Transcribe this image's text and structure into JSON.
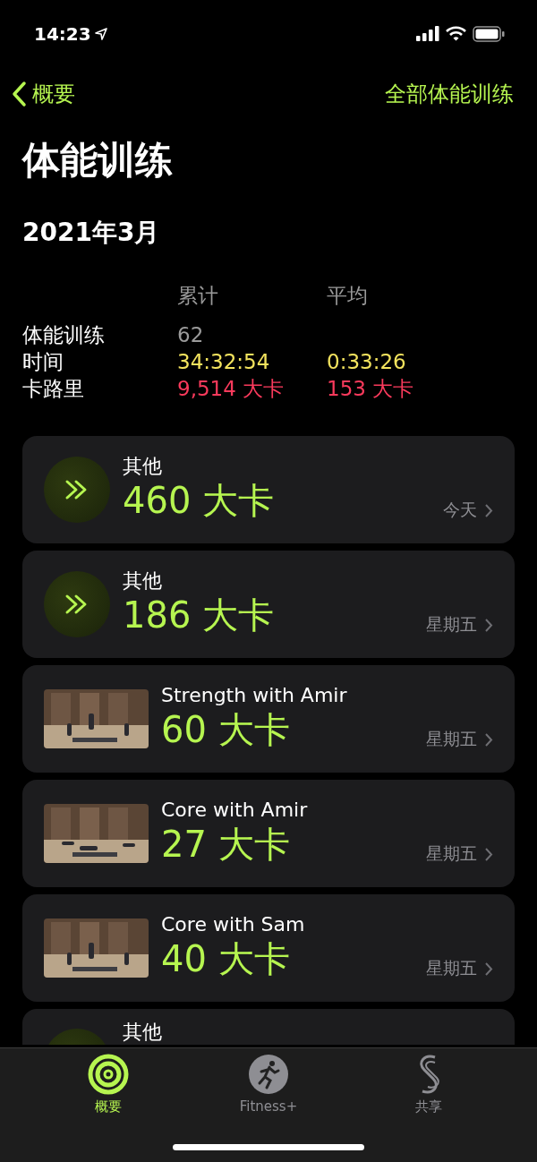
{
  "status_bar": {
    "time": "14:23"
  },
  "nav": {
    "back_label": "概要",
    "action_label": "全部体能训练"
  },
  "title": "体能训练",
  "month": "2021年3月",
  "summary": {
    "columns": [
      "累计",
      "平均"
    ],
    "rows": [
      {
        "kind": "count",
        "label": "体能训练",
        "values": [
          "62"
        ]
      },
      {
        "kind": "time",
        "label": "时间",
        "values": [
          "34:32:54",
          "0:33:26"
        ]
      },
      {
        "kind": "calories",
        "label": "卡路里",
        "values": [
          "9,514 大卡",
          "153 大卡"
        ]
      }
    ]
  },
  "workouts": [
    {
      "kind": "icon",
      "title": "其他",
      "calories": "460 大卡",
      "day": "今天"
    },
    {
      "kind": "icon",
      "title": "其他",
      "calories": "186 大卡",
      "day": "星期五"
    },
    {
      "kind": "picture",
      "title": "Strength with Amir",
      "calories": "60 大卡",
      "day": "星期五"
    },
    {
      "kind": "picture",
      "title": "Core with Amir",
      "calories": "27 大卡",
      "day": "星期五"
    },
    {
      "kind": "picture",
      "title": "Core with Sam",
      "calories": "40 大卡",
      "day": "星期五"
    },
    {
      "kind": "icon",
      "title": "其他"
    }
  ],
  "tab_bar": [
    {
      "kind": "summary",
      "label": "概要",
      "selected": true
    },
    {
      "kind": "fitness",
      "label": "Fitness+",
      "selected": false
    },
    {
      "kind": "sharing",
      "label": "共享",
      "selected": false
    }
  ]
}
